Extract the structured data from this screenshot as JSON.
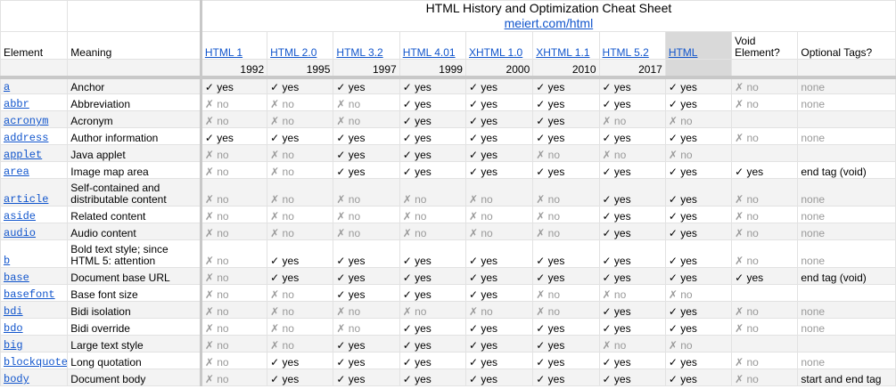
{
  "title": "HTML History and Optimization Cheat Sheet",
  "subtitle": "meiert.com/html",
  "columns": {
    "element": "Element",
    "meaning": "Meaning",
    "versions": [
      {
        "name": "HTML 1",
        "year": "1992"
      },
      {
        "name": "HTML 2.0",
        "year": "1995"
      },
      {
        "name": "HTML 3.2",
        "year": "1997"
      },
      {
        "name": "HTML 4.01",
        "year": "1999"
      },
      {
        "name": "XHTML 1.0",
        "year": "2000"
      },
      {
        "name": "XHTML 1.1",
        "year": "2010"
      },
      {
        "name": "HTML 5.2",
        "year": "2017"
      },
      {
        "name": "HTML",
        "year": ""
      }
    ],
    "void": "Void Element?",
    "optional": "Optional Tags?"
  },
  "rows": [
    {
      "el": "a",
      "meaning": "Anchor",
      "v": [
        "✓ yes",
        "✓ yes",
        "✓ yes",
        "✓ yes",
        "✓ yes",
        "✓ yes",
        "✓ yes",
        "✓ yes"
      ],
      "void": "✗ no",
      "opt": "none"
    },
    {
      "el": "abbr",
      "meaning": "Abbreviation",
      "v": [
        "✗ no",
        "✗ no",
        "✗ no",
        "✓ yes",
        "✓ yes",
        "✓ yes",
        "✓ yes",
        "✓ yes"
      ],
      "void": "✗ no",
      "opt": "none"
    },
    {
      "el": "acronym",
      "meaning": "Acronym",
      "v": [
        "✗ no",
        "✗ no",
        "✗ no",
        "✓ yes",
        "✓ yes",
        "✓ yes",
        "✗ no",
        "✗ no"
      ],
      "void": "",
      "opt": ""
    },
    {
      "el": "address",
      "meaning": "Author information",
      "v": [
        "✓ yes",
        "✓ yes",
        "✓ yes",
        "✓ yes",
        "✓ yes",
        "✓ yes",
        "✓ yes",
        "✓ yes"
      ],
      "void": "✗ no",
      "opt": "none"
    },
    {
      "el": "applet",
      "meaning": "Java applet",
      "v": [
        "✗ no",
        "✗ no",
        "✓ yes",
        "✓ yes",
        "✓ yes",
        "✗ no",
        "✗ no",
        "✗ no"
      ],
      "void": "",
      "opt": ""
    },
    {
      "el": "area",
      "meaning": "Image map area",
      "v": [
        "✗ no",
        "✗ no",
        "✓ yes",
        "✓ yes",
        "✓ yes",
        "✓ yes",
        "✓ yes",
        "✓ yes"
      ],
      "void": "✓ yes",
      "opt": "end tag (void)"
    },
    {
      "el": "article",
      "meaning": "Self-contained and distributable content",
      "v": [
        "✗ no",
        "✗ no",
        "✗ no",
        "✗ no",
        "✗ no",
        "✗ no",
        "✓ yes",
        "✓ yes"
      ],
      "void": "✗ no",
      "opt": "none",
      "tall": true
    },
    {
      "el": "aside",
      "meaning": "Related content",
      "v": [
        "✗ no",
        "✗ no",
        "✗ no",
        "✗ no",
        "✗ no",
        "✗ no",
        "✓ yes",
        "✓ yes"
      ],
      "void": "✗ no",
      "opt": "none"
    },
    {
      "el": "audio",
      "meaning": "Audio content",
      "v": [
        "✗ no",
        "✗ no",
        "✗ no",
        "✗ no",
        "✗ no",
        "✗ no",
        "✓ yes",
        "✓ yes"
      ],
      "void": "✗ no",
      "opt": "none"
    },
    {
      "el": "b",
      "meaning": "Bold text style; since HTML 5: attention",
      "v": [
        "✗ no",
        "✓ yes",
        "✓ yes",
        "✓ yes",
        "✓ yes",
        "✓ yes",
        "✓ yes",
        "✓ yes"
      ],
      "void": "✗ no",
      "opt": "none",
      "tall": true
    },
    {
      "el": "base",
      "meaning": "Document base URL",
      "v": [
        "✗ no",
        "✓ yes",
        "✓ yes",
        "✓ yes",
        "✓ yes",
        "✓ yes",
        "✓ yes",
        "✓ yes"
      ],
      "void": "✓ yes",
      "opt": "end tag (void)"
    },
    {
      "el": "basefont",
      "meaning": "Base font size",
      "v": [
        "✗ no",
        "✗ no",
        "✓ yes",
        "✓ yes",
        "✓ yes",
        "✗ no",
        "✗ no",
        "✗ no"
      ],
      "void": "",
      "opt": ""
    },
    {
      "el": "bdi",
      "meaning": "Bidi isolation",
      "v": [
        "✗ no",
        "✗ no",
        "✗ no",
        "✗ no",
        "✗ no",
        "✗ no",
        "✓ yes",
        "✓ yes"
      ],
      "void": "✗ no",
      "opt": "none"
    },
    {
      "el": "bdo",
      "meaning": "Bidi override",
      "v": [
        "✗ no",
        "✗ no",
        "✗ no",
        "✓ yes",
        "✓ yes",
        "✓ yes",
        "✓ yes",
        "✓ yes"
      ],
      "void": "✗ no",
      "opt": "none"
    },
    {
      "el": "big",
      "meaning": "Large text style",
      "v": [
        "✗ no",
        "✗ no",
        "✓ yes",
        "✓ yes",
        "✓ yes",
        "✓ yes",
        "✗ no",
        "✗ no"
      ],
      "void": "",
      "opt": ""
    },
    {
      "el": "blockquote",
      "meaning": "Long quotation",
      "v": [
        "✗ no",
        "✓ yes",
        "✓ yes",
        "✓ yes",
        "✓ yes",
        "✓ yes",
        "✓ yes",
        "✓ yes"
      ],
      "void": "✗ no",
      "opt": "none"
    },
    {
      "el": "body",
      "meaning": "Document body",
      "v": [
        "✗ no",
        "✓ yes",
        "✓ yes",
        "✓ yes",
        "✓ yes",
        "✓ yes",
        "✓ yes",
        "✓ yes"
      ],
      "void": "✗ no",
      "opt": "start and end tag"
    }
  ]
}
